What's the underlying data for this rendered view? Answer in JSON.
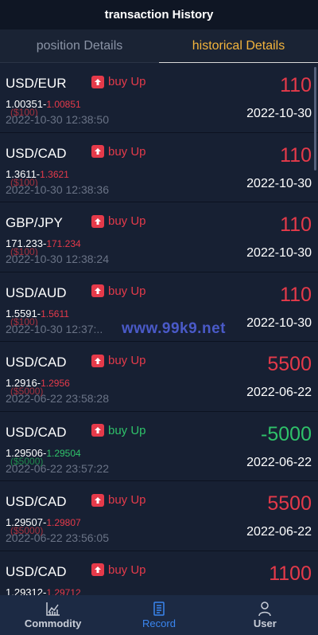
{
  "header": {
    "title": "transaction History"
  },
  "tabs": [
    {
      "label": "position Details",
      "active": false
    },
    {
      "label": "historical Details",
      "active": true
    }
  ],
  "records": [
    {
      "pair": "USD/EUR",
      "direction": "buy Up",
      "direction_color": "red",
      "amount": "110",
      "amount_color": "red",
      "open": "1.00351-",
      "close": "1.00851",
      "stake": "($100)",
      "time": "2022-10-30 12:38:50",
      "date": "2022-10-30"
    },
    {
      "pair": "USD/CAD",
      "direction": "buy Up",
      "direction_color": "red",
      "amount": "110",
      "amount_color": "red",
      "open": "1.3611-",
      "close": "1.3621",
      "stake": "($100)",
      "time": "2022-10-30 12:38:36",
      "date": "2022-10-30"
    },
    {
      "pair": "GBP/JPY",
      "direction": "buy Up",
      "direction_color": "red",
      "amount": "110",
      "amount_color": "red",
      "open": "171.233-",
      "close": "171.234",
      "stake": "($100)",
      "time": "2022-10-30 12:38:24",
      "date": "2022-10-30"
    },
    {
      "pair": "USD/AUD",
      "direction": "buy Up",
      "direction_color": "red",
      "amount": "110",
      "amount_color": "red",
      "open": "1.5591-",
      "close": "1.5611",
      "stake": "($100)",
      "time": "2022-10-30 12:37:..",
      "date": "2022-10-30"
    },
    {
      "pair": "USD/CAD",
      "direction": "buy Up",
      "direction_color": "red",
      "amount": "5500",
      "amount_color": "red",
      "open": "1.2916-",
      "close": "1.2956",
      "stake": "($5000)",
      "time": "2022-06-22 23:58:28",
      "date": "2022-06-22"
    },
    {
      "pair": "USD/CAD",
      "direction": "buy Up",
      "direction_color": "green",
      "amount": "-5000",
      "amount_color": "green",
      "open": "1.29506-",
      "close": "1.29504",
      "stake": "($5000)",
      "time": "2022-06-22 23:57:22",
      "date": "2022-06-22"
    },
    {
      "pair": "USD/CAD",
      "direction": "buy Up",
      "direction_color": "red",
      "amount": "5500",
      "amount_color": "red",
      "open": "1.29507-",
      "close": "1.29807",
      "stake": "($5000)",
      "time": "2022-06-22 23:56:05",
      "date": "2022-06-22"
    },
    {
      "pair": "USD/CAD",
      "direction": "buy Up",
      "direction_color": "red",
      "amount": "1100",
      "amount_color": "red",
      "open": "1.29312-",
      "close": "1.29712",
      "stake": "",
      "time": "",
      "date": ""
    }
  ],
  "watermark": "www.99k9.net",
  "nav": [
    {
      "label": "Commodity",
      "icon": "chart-icon",
      "active": false
    },
    {
      "label": "Record",
      "icon": "document-icon",
      "active": true
    },
    {
      "label": "User",
      "icon": "user-icon",
      "active": false
    }
  ],
  "colors": {
    "up": "#e53a4a",
    "down": "#2fc26a",
    "accent": "#f3b43c",
    "nav_active": "#3a86f0"
  }
}
